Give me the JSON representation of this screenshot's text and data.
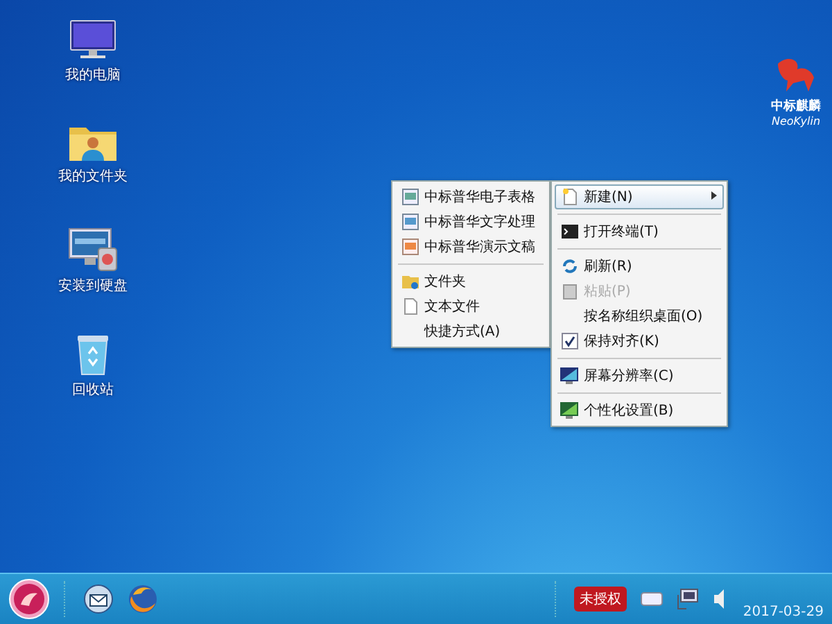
{
  "desktop": {
    "icons": [
      {
        "label": "我的电脑"
      },
      {
        "label": "我的文件夹"
      },
      {
        "label": "安装到硬盘"
      },
      {
        "label": "回收站"
      }
    ],
    "logo": {
      "title": "中标麒麟",
      "subtitle": "NeoKylin"
    }
  },
  "submenu": {
    "items": [
      {
        "kind": "item",
        "label": "中标普华电子表格"
      },
      {
        "kind": "item",
        "label": "中标普华文字处理"
      },
      {
        "kind": "item",
        "label": "中标普华演示文稿"
      },
      {
        "kind": "separator"
      },
      {
        "kind": "item",
        "label": "文件夹"
      },
      {
        "kind": "item",
        "label": "文本文件"
      },
      {
        "kind": "item",
        "label": "快捷方式(A)"
      }
    ]
  },
  "context_menu": {
    "items": [
      {
        "kind": "submenu",
        "label": "新建(N)",
        "selected": true,
        "disabled": false
      },
      {
        "kind": "separator"
      },
      {
        "kind": "item",
        "label": "打开终端(T)",
        "selected": false,
        "disabled": false
      },
      {
        "kind": "separator"
      },
      {
        "kind": "item",
        "label": "刷新(R)",
        "selected": false,
        "disabled": false
      },
      {
        "kind": "item",
        "label": "粘贴(P)",
        "selected": false,
        "disabled": true
      },
      {
        "kind": "item",
        "label": "按名称组织桌面(O)",
        "selected": false,
        "disabled": false
      },
      {
        "kind": "check",
        "label": "保持对齐(K)",
        "selected": false,
        "disabled": false,
        "checked": true
      },
      {
        "kind": "separator"
      },
      {
        "kind": "item",
        "label": "屏幕分辨率(C)",
        "selected": false,
        "disabled": false
      },
      {
        "kind": "separator"
      },
      {
        "kind": "item",
        "label": "个性化设置(B)",
        "selected": false,
        "disabled": false
      }
    ]
  },
  "taskbar": {
    "badge": "未授权",
    "date": "2017-03-29"
  }
}
